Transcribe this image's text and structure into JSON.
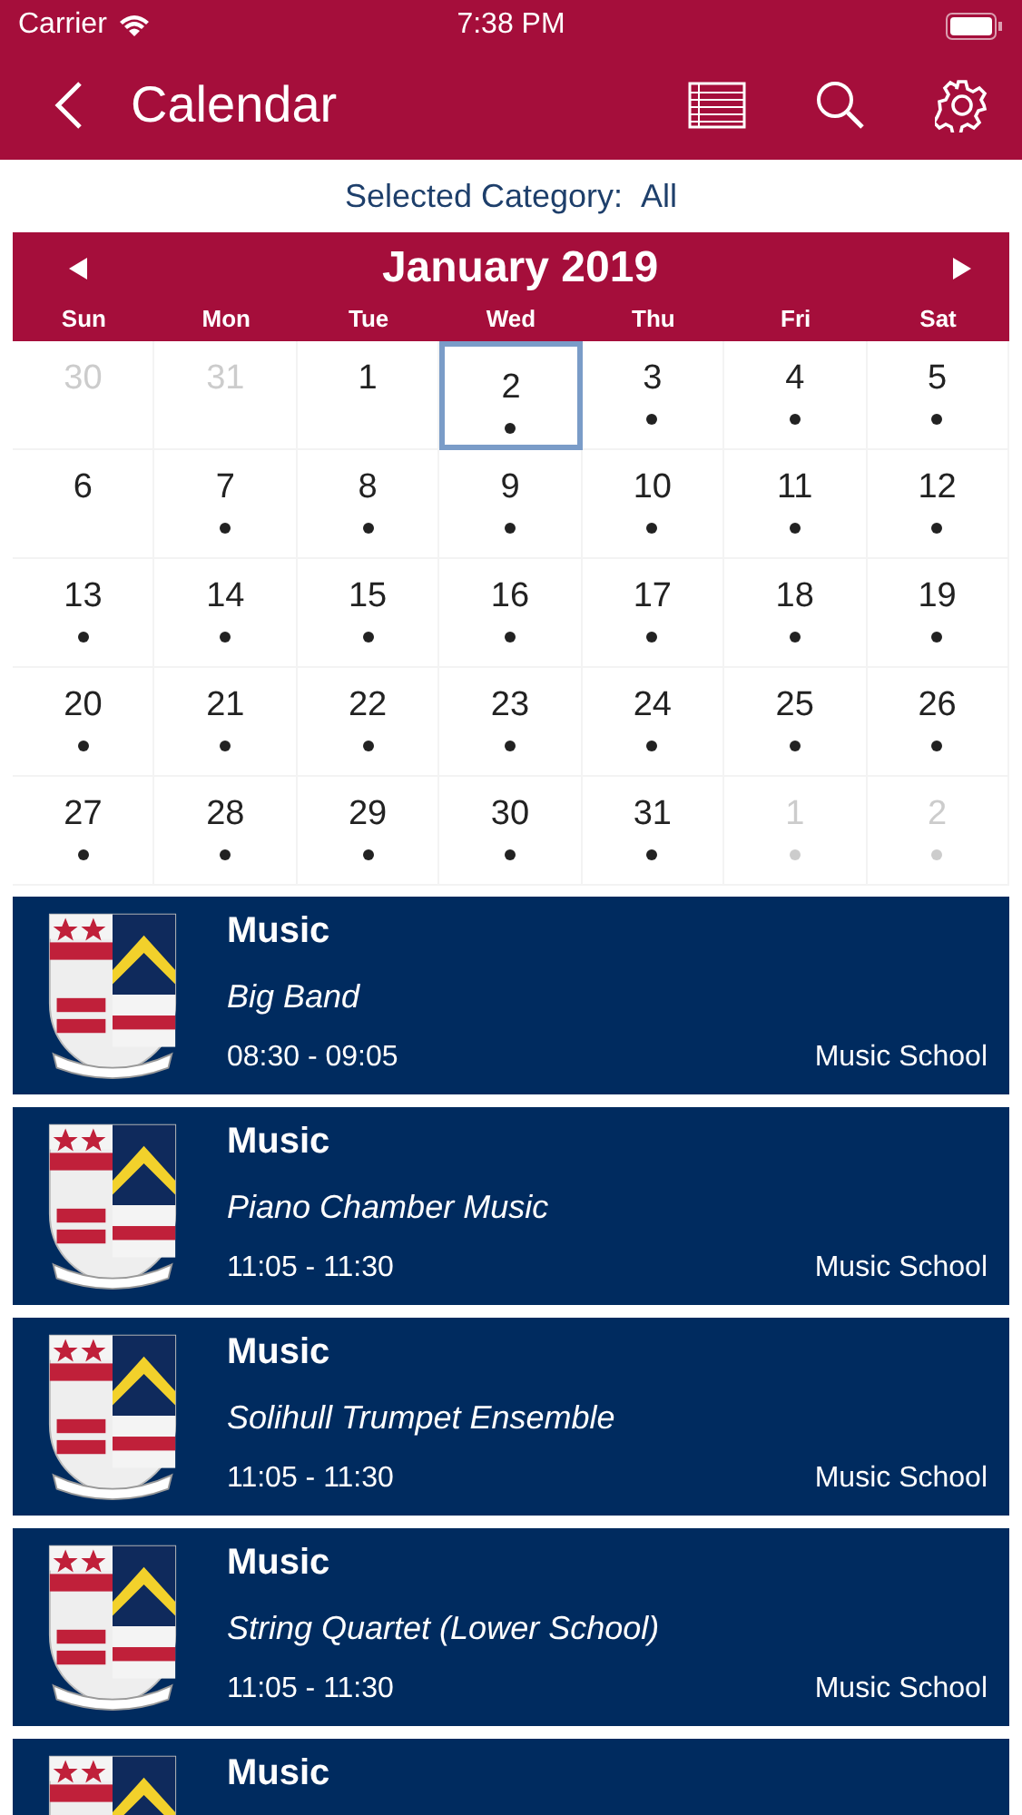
{
  "status_bar": {
    "carrier": "Carrier",
    "time": "7:38 PM"
  },
  "nav": {
    "title": "Calendar"
  },
  "category": {
    "label": "Selected Category:",
    "value": "All"
  },
  "calendar": {
    "month": "January 2019",
    "weekdays": [
      "Sun",
      "Mon",
      "Tue",
      "Wed",
      "Thu",
      "Fri",
      "Sat"
    ],
    "days": [
      {
        "day": "30",
        "outside": true,
        "has_event": false,
        "selected": false
      },
      {
        "day": "31",
        "outside": true,
        "has_event": false,
        "selected": false
      },
      {
        "day": "1",
        "outside": false,
        "has_event": false,
        "selected": false
      },
      {
        "day": "2",
        "outside": false,
        "has_event": true,
        "selected": true
      },
      {
        "day": "3",
        "outside": false,
        "has_event": true,
        "selected": false
      },
      {
        "day": "4",
        "outside": false,
        "has_event": true,
        "selected": false
      },
      {
        "day": "5",
        "outside": false,
        "has_event": true,
        "selected": false
      },
      {
        "day": "6",
        "outside": false,
        "has_event": false,
        "selected": false
      },
      {
        "day": "7",
        "outside": false,
        "has_event": true,
        "selected": false
      },
      {
        "day": "8",
        "outside": false,
        "has_event": true,
        "selected": false
      },
      {
        "day": "9",
        "outside": false,
        "has_event": true,
        "selected": false
      },
      {
        "day": "10",
        "outside": false,
        "has_event": true,
        "selected": false
      },
      {
        "day": "11",
        "outside": false,
        "has_event": true,
        "selected": false
      },
      {
        "day": "12",
        "outside": false,
        "has_event": true,
        "selected": false
      },
      {
        "day": "13",
        "outside": false,
        "has_event": true,
        "selected": false
      },
      {
        "day": "14",
        "outside": false,
        "has_event": true,
        "selected": false
      },
      {
        "day": "15",
        "outside": false,
        "has_event": true,
        "selected": false
      },
      {
        "day": "16",
        "outside": false,
        "has_event": true,
        "selected": false
      },
      {
        "day": "17",
        "outside": false,
        "has_event": true,
        "selected": false
      },
      {
        "day": "18",
        "outside": false,
        "has_event": true,
        "selected": false
      },
      {
        "day": "19",
        "outside": false,
        "has_event": true,
        "selected": false
      },
      {
        "day": "20",
        "outside": false,
        "has_event": true,
        "selected": false
      },
      {
        "day": "21",
        "outside": false,
        "has_event": true,
        "selected": false
      },
      {
        "day": "22",
        "outside": false,
        "has_event": true,
        "selected": false
      },
      {
        "day": "23",
        "outside": false,
        "has_event": true,
        "selected": false
      },
      {
        "day": "24",
        "outside": false,
        "has_event": true,
        "selected": false
      },
      {
        "day": "25",
        "outside": false,
        "has_event": true,
        "selected": false
      },
      {
        "day": "26",
        "outside": false,
        "has_event": true,
        "selected": false
      },
      {
        "day": "27",
        "outside": false,
        "has_event": true,
        "selected": false
      },
      {
        "day": "28",
        "outside": false,
        "has_event": true,
        "selected": false
      },
      {
        "day": "29",
        "outside": false,
        "has_event": true,
        "selected": false
      },
      {
        "day": "30",
        "outside": false,
        "has_event": true,
        "selected": false
      },
      {
        "day": "31",
        "outside": false,
        "has_event": true,
        "selected": false
      },
      {
        "day": "1",
        "outside": true,
        "has_event": true,
        "selected": false
      },
      {
        "day": "2",
        "outside": true,
        "has_event": true,
        "selected": false
      }
    ]
  },
  "events": [
    {
      "category": "Music",
      "title": "Big Band",
      "time": "08:30 - 09:05",
      "location": "Music School"
    },
    {
      "category": "Music",
      "title": "Piano Chamber Music",
      "time": "11:05 - 11:30",
      "location": "Music School"
    },
    {
      "category": "Music",
      "title": "Solihull Trumpet Ensemble",
      "time": "11:05 - 11:30",
      "location": "Music School"
    },
    {
      "category": "Music",
      "title": "String Quartet (Lower School)",
      "time": "11:05 - 11:30",
      "location": "Music School"
    },
    {
      "category": "Music"
    }
  ]
}
